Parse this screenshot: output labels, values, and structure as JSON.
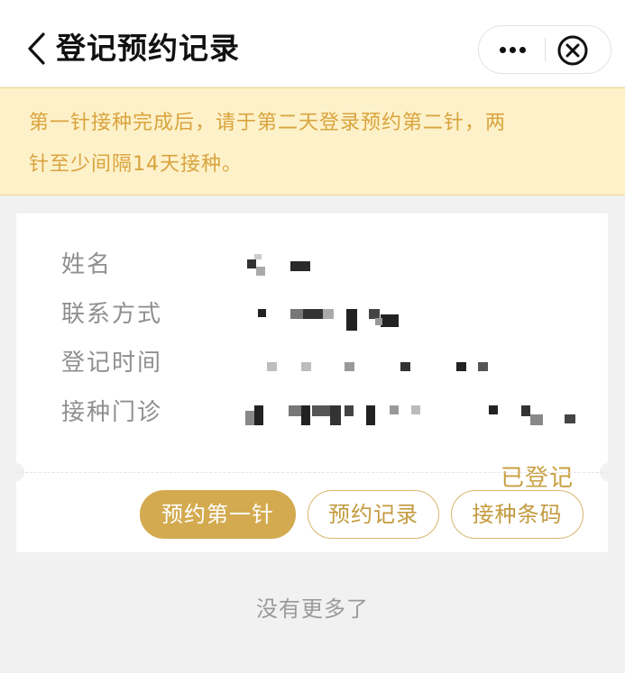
{
  "nav": {
    "title": "登记预约记录",
    "back_icon": "chevron-left-icon",
    "more_icon": "more-dots-icon",
    "close_icon": "close-circle-icon"
  },
  "notice": {
    "line1": "第一针接种完成后，请于第二天登录预约第二针，两",
    "line2": "针至少间隔14天接种。"
  },
  "record": {
    "status": "已登记",
    "fields": [
      {
        "label": "姓名"
      },
      {
        "label": "联系方式"
      },
      {
        "label": "登记时间"
      },
      {
        "label": "接种门诊"
      }
    ]
  },
  "actions": {
    "book_first": "预约第一针",
    "records": "预约记录",
    "barcode": "接种条码"
  },
  "footer": {
    "text": "没有更多了"
  },
  "colors": {
    "accent": "#d3aa4f",
    "notice_bg": "#fdf1c9",
    "notice_text": "#d9a43e",
    "status_text": "#c9a043"
  }
}
